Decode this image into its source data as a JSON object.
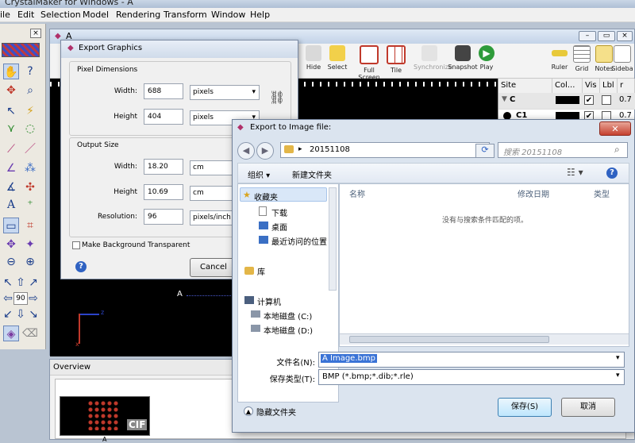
{
  "app": {
    "title": "CrystalMaker for Windows - A"
  },
  "menu": [
    "File",
    "Edit",
    "Selection",
    "Model",
    "Rendering",
    "Transform",
    "Window",
    "Help"
  ],
  "menu_visible": [
    "ile",
    "Edit",
    "Selection",
    "Model",
    "Rendering",
    "Transform",
    "Window",
    "Help"
  ],
  "palette": {
    "rotate_value": "90"
  },
  "document": {
    "title": "A",
    "toolbar": [
      "Hide",
      "Select",
      "Full Screen",
      "Tile",
      "Synchronize",
      "Snapshot",
      "Play",
      "Ruler",
      "Grid",
      "Notes",
      "Sidebar"
    ],
    "toolbar_visible": [
      "Hide",
      "Select",
      "Full Screen",
      "Tile",
      "Synchronize",
      "Snapshot",
      "Play",
      "Ruler",
      "Grid",
      "Notes",
      "Sideba"
    ],
    "canvas_label": "A",
    "axes": {
      "x": "x",
      "z": "z"
    },
    "grid_headers": [
      "Site",
      "Col...",
      "Vis",
      "Lbl",
      "r [Å"
    ],
    "grid_rows": [
      {
        "site": "C",
        "color": "#000000",
        "vis": true,
        "lbl": false,
        "r": "0.7"
      },
      {
        "site": "C1",
        "color": "#000000",
        "vis": true,
        "lbl": false,
        "r": "0.7"
      }
    ]
  },
  "overview": {
    "title": "Overview",
    "thumb_badge": "CIF",
    "thumb_label": "A"
  },
  "export_graphics": {
    "title": "Export Graphics",
    "pixel_dimensions": "Pixel Dimensions",
    "width_label": "Width:",
    "width_value": "688",
    "width_unit": "pixels",
    "height_label": "Height",
    "height_value": "404",
    "height_unit": "pixels",
    "output_size": "Output Size",
    "out_width_label": "Width:",
    "out_width_value": "18.20",
    "out_width_unit": "cm",
    "out_height_label": "Height",
    "out_height_value": "10.69",
    "out_height_unit": "cm",
    "resolution_label": "Resolution:",
    "resolution_value": "96",
    "resolution_unit": "pixels/inch",
    "transparent_label": "Make Background Transparent",
    "cancel_label": "Cancel",
    "help": "?"
  },
  "file_dialog": {
    "title": "Export to Image file:",
    "path": "20151108",
    "search_placeholder": "搜索 20151108",
    "organize": "组织 ▾",
    "new_folder": "新建文件夹",
    "nav": {
      "favorites": "收藏夹",
      "downloads": "下载",
      "desktop": "桌面",
      "recent": "最近访问的位置",
      "libraries": "库",
      "computer": "计算机",
      "disk_c": "本地磁盘 (C:)",
      "disk_d": "本地磁盘 (D:)"
    },
    "columns": {
      "name": "名称",
      "modified": "修改日期",
      "type": "类型"
    },
    "empty_message": "没有与搜索条件匹配的项。",
    "filename_label": "文件名(N):",
    "filename_value": "A Image.bmp",
    "filetype_label": "保存类型(T):",
    "filetype_value": "BMP (*.bmp;*.dib;*.rle)",
    "hide_folders": "隐藏文件夹",
    "save_label": "保存(S)",
    "cancel_label": "取消",
    "help": "?"
  }
}
